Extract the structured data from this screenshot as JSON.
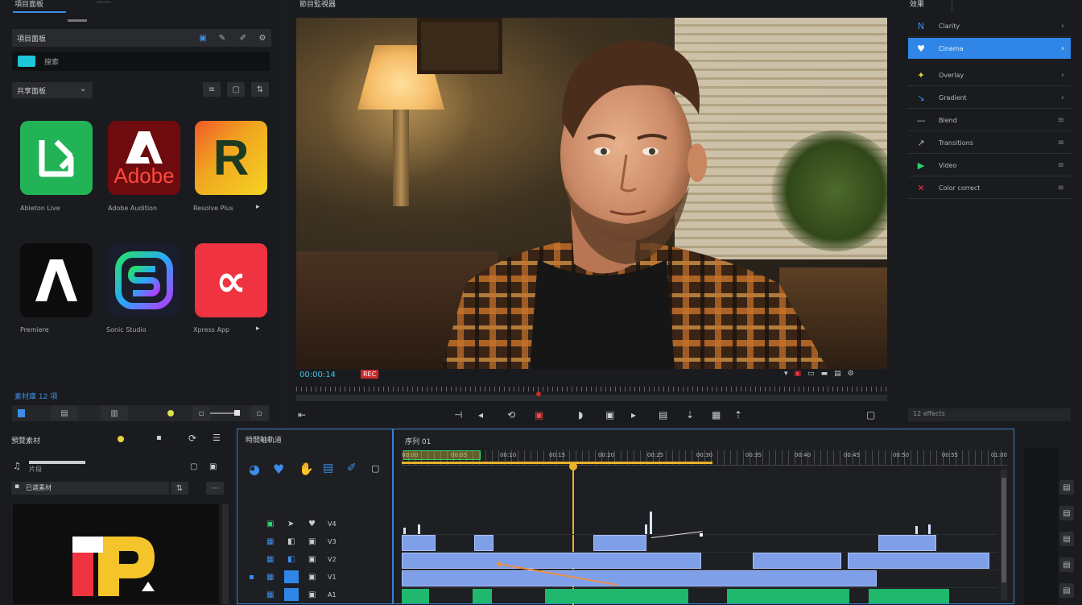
{
  "app": {
    "accent": "#3d8de8",
    "playhead_color": "#e8b22a"
  },
  "top_left_tab": {
    "label": "項目面板",
    "secondary": "——"
  },
  "library": {
    "header_title": "項目面板",
    "search_text": "搜索",
    "section_title": "共享面板",
    "tiles": [
      {
        "name": "green-tile",
        "label": "Ableton Live",
        "bg": "#22b357",
        "glyph": "↳"
      },
      {
        "name": "adobe-tile",
        "label": "Adobe Audition",
        "bg": "#6d0b0e",
        "glyph": "Adobe"
      },
      {
        "name": "r-tile",
        "label": "Resolve Plus",
        "bg": "#f0a81f",
        "glyph": "R"
      },
      {
        "name": "a-tile",
        "label": "Premiere",
        "bg": "#0c0c0c",
        "glyph": "A"
      },
      {
        "name": "s-tile",
        "label": "Sonic Studio",
        "bg": "#1a1d2b",
        "glyph": "S"
      },
      {
        "name": "x-tile",
        "label": "Xpress App",
        "bg": "#ef3340",
        "glyph": "∝"
      }
    ],
    "footer_label": "素材庫 12 項"
  },
  "viewer": {
    "title": "節目監視器",
    "timecode": "00:00:14",
    "rec_label": "REC"
  },
  "effects": {
    "tab_label": "效果",
    "items": [
      {
        "label": "Clarity",
        "icon": "N",
        "active": false
      },
      {
        "label": "Cinema",
        "icon": "♥",
        "active": true
      },
      {
        "label": "Overlay",
        "icon": "✦",
        "active": false
      },
      {
        "label": "Gradient",
        "icon": "↘",
        "active": false
      },
      {
        "label": "Blend",
        "icon": "—",
        "active": false
      },
      {
        "label": "Transitions",
        "icon": "↗",
        "active": false
      },
      {
        "label": "Video",
        "icon": "▶",
        "active": false
      },
      {
        "label": "Color correct",
        "icon": "✕",
        "active": false
      }
    ],
    "footer": "12 effects"
  },
  "bin": {
    "title": "預覽素材",
    "sub_title": "片段",
    "list_title": "已選素材",
    "clip_glyph": "1P"
  },
  "tracks": {
    "title": "時間軸軌道",
    "rows": [
      {
        "label": "V4"
      },
      {
        "label": "V3"
      },
      {
        "label": "V2"
      },
      {
        "label": "V1"
      },
      {
        "label": "A1"
      }
    ]
  },
  "timeline": {
    "title": "序列 01",
    "ruler_ticks": [
      "00:00",
      "00:05",
      "00:10",
      "00:15",
      "00:20",
      "00:25",
      "00:30",
      "00:35",
      "00:40",
      "00:45",
      "00:50",
      "00:55",
      "01:00"
    ]
  }
}
